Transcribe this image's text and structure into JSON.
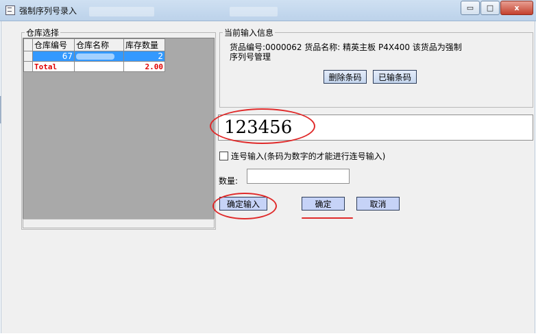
{
  "window": {
    "title": "强制序列号录入",
    "controls": {
      "minimize": "▭",
      "maximize": "□",
      "close": "x"
    }
  },
  "warehouse_group": {
    "legend": "仓库选择",
    "columns": [
      "仓库编号",
      "仓库名称",
      "库存数量"
    ],
    "rows": [
      {
        "code": "67",
        "name": "",
        "qty": "2"
      }
    ],
    "total": {
      "label": "Total",
      "qty": "2.00"
    }
  },
  "info_group": {
    "legend": "当前输入信息",
    "text_line1": "货品编号:0000062  货品名称: 精英主板 P4X400  该货品为强制",
    "text_line2": "序列号管理",
    "delete_button": "删除条码",
    "entered_button": "已输条码"
  },
  "barcode_input": {
    "value": "123456"
  },
  "serial_checkbox": {
    "label": "连号输入(条码为数字的才能进行连号输入)",
    "checked": false
  },
  "quantity": {
    "label": "数量:",
    "value": ""
  },
  "buttons": {
    "confirm_input": "确定输入",
    "ok": "确定",
    "cancel": "取消"
  },
  "colors": {
    "annotation": "#e02a2a",
    "selection": "#3399ff",
    "total_text": "#e00000"
  }
}
